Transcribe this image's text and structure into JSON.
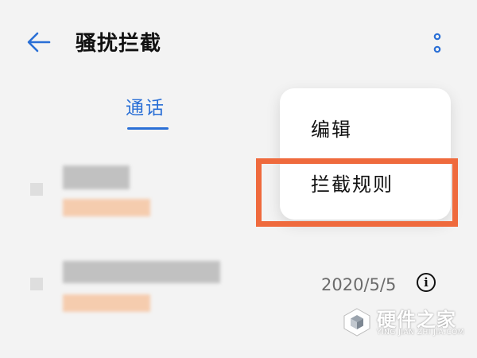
{
  "header": {
    "title": "骚扰拦截",
    "back_icon": "arrow-left-icon",
    "more_icon": "more-vertical-icon",
    "accent_color": "#2a6fd6"
  },
  "tabs": [
    {
      "label": "通话",
      "selected": true
    }
  ],
  "entries": [
    {
      "date": ""
    },
    {
      "date": "2020/5/5",
      "info_icon": "info-icon",
      "info_glyph": "i"
    }
  ],
  "menu": {
    "items": [
      {
        "label": "编辑"
      },
      {
        "label": "拦截规则",
        "highlighted": true
      }
    ],
    "highlight_color": "#ef6a3d"
  },
  "watermark": {
    "title": "硬件之家",
    "subtitle": "YING JIAN ZHI JIA.COM"
  }
}
